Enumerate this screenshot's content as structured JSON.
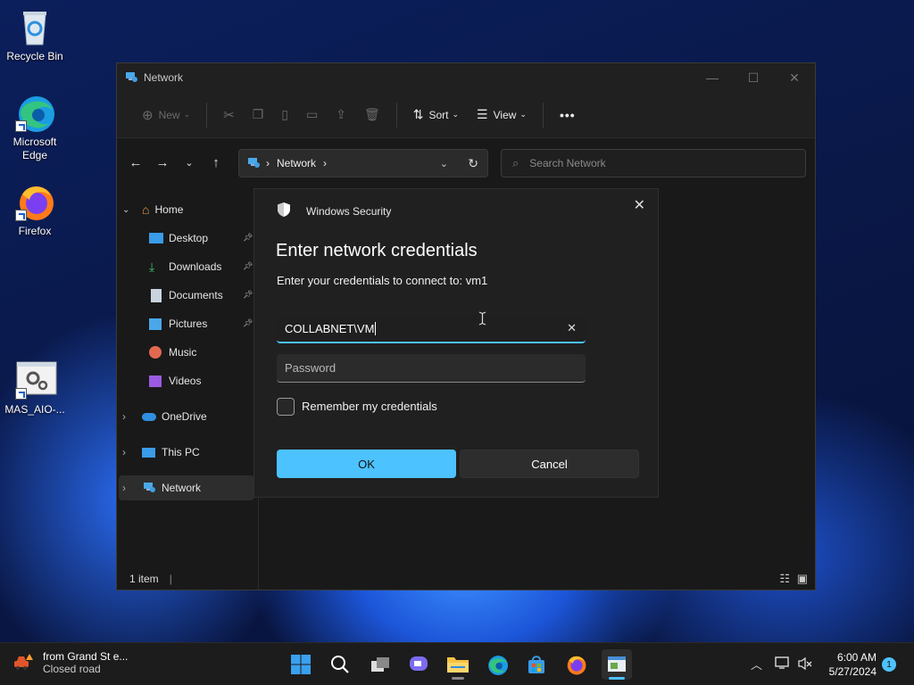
{
  "desktop": {
    "icons": [
      {
        "label": "Recycle Bin"
      },
      {
        "label": "Microsoft Edge"
      },
      {
        "label": "Firefox"
      },
      {
        "label": "MAS_AIO-..."
      }
    ]
  },
  "window": {
    "title": "Network",
    "toolbar": {
      "new_label": "New",
      "sort_label": "Sort",
      "view_label": "View",
      "more_label": "•••"
    },
    "address": {
      "location": "Network"
    },
    "search": {
      "placeholder": "Search Network"
    },
    "sidebar": {
      "items": [
        {
          "label": "Home"
        },
        {
          "label": "Desktop"
        },
        {
          "label": "Downloads"
        },
        {
          "label": "Documents"
        },
        {
          "label": "Pictures"
        },
        {
          "label": "Music"
        },
        {
          "label": "Videos"
        },
        {
          "label": "OneDrive"
        },
        {
          "label": "This PC"
        },
        {
          "label": "Network"
        }
      ]
    },
    "status": {
      "count": "1 item"
    }
  },
  "dialog": {
    "app_name": "Windows Security",
    "title": "Enter network credentials",
    "subtitle": "Enter your credentials to connect to: vm1",
    "username_value": "COLLABNET\\VM",
    "password_placeholder": "Password",
    "remember_label": "Remember my credentials",
    "ok_label": "OK",
    "cancel_label": "Cancel"
  },
  "taskbar": {
    "weather_line1": "from Grand St e...",
    "weather_line2": "Closed road",
    "time": "6:00 AM",
    "date": "5/27/2024",
    "notification_count": "1"
  },
  "colors": {
    "accent": "#4cc2ff",
    "window_bg": "#191919",
    "dialog_bg": "#202020",
    "taskbar_bg": "#1c1c1c"
  }
}
